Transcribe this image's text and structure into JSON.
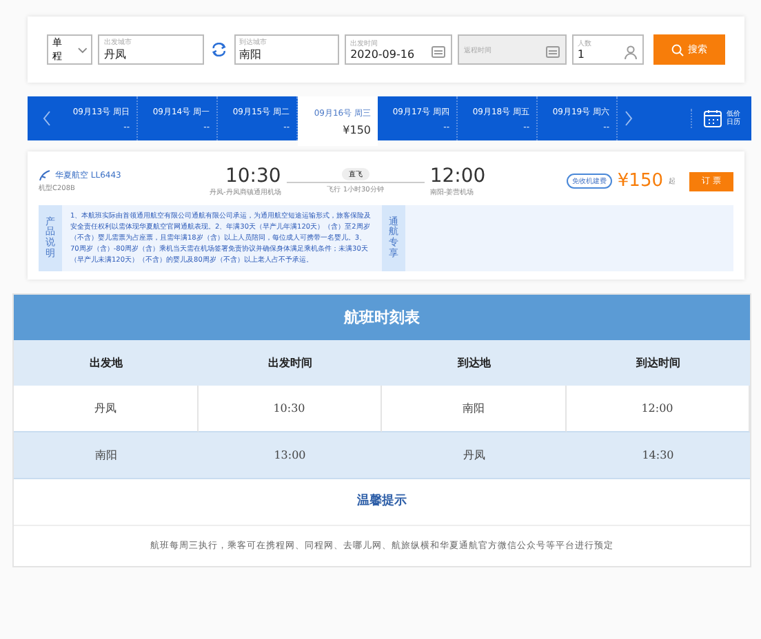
{
  "search": {
    "trip_type": "单程",
    "from": {
      "label": "出发城市",
      "value": "丹凤"
    },
    "to": {
      "label": "到达城市",
      "value": "南阳"
    },
    "depart": {
      "label": "出发时间",
      "value": "2020-09-16"
    },
    "return": {
      "label": "返程时间",
      "disabled": true
    },
    "passengers": {
      "label": "人数",
      "value": "1"
    },
    "button": "搜索"
  },
  "dates": [
    {
      "date": "09月13号 周日",
      "price": "--",
      "selected": false
    },
    {
      "date": "09月14号 周一",
      "price": "--",
      "selected": false
    },
    {
      "date": "09月15号 周二",
      "price": "--",
      "selected": false
    },
    {
      "date": "09月16号 周三",
      "price": "¥150",
      "selected": true
    },
    {
      "date": "09月17号 周四",
      "price": "--",
      "selected": false
    },
    {
      "date": "09月18号 周五",
      "price": "--",
      "selected": false
    },
    {
      "date": "09月19号 周六",
      "price": "--",
      "selected": false
    }
  ],
  "calendar_label": "低价日历",
  "flight": {
    "airline": "华夏航空 LL6443",
    "aircraft": "机型C208B",
    "depart_time": "10:30",
    "depart_airport": "丹凤-丹凤商镇通用机场",
    "type": "直飞",
    "duration": "飞行 1小时30分钟",
    "arrive_time": "12:00",
    "arrive_airport": "南阳-姜营机场",
    "tag": "免收机建费",
    "price": "¥150",
    "price_suffix": "起",
    "book": "订 票",
    "notice_title": "产品说明",
    "notice": "1、本航班实际由首领通用航空有限公司通航有限公司承运，为通用航空短途运输形式，旅客保险及安全责任权利以需体现华夏航空官网通航表现。2、年满30天（早产儿年满120天）（含）至2周岁（不含）婴儿需票为占座票，且需年满18岁（含）以上人员陪同，每位成人可携带一名婴儿。3、70周岁（含）-80周岁（含）乘机当天需在机场签署免责协议并确保身体满足乘机条件；未满30天（早产儿未满120天）（不含）的婴儿及80周岁（不含）以上老人占不予承运。",
    "side_title": "通航专享"
  },
  "timetable": {
    "title": "航班时刻表",
    "columns": [
      "出发地",
      "出发时间",
      "到达地",
      "到达时间"
    ],
    "rows": [
      [
        "丹凤",
        "10:30",
        "南阳",
        "12:00"
      ],
      [
        "南阳",
        "13:00",
        "丹凤",
        "14:30"
      ]
    ],
    "tips_title": "温馨提示",
    "tips": "航班每周三执行，乘客可在携程网、同程网、去哪儿网、航旅纵横和华夏通航官方微信公众号等平台进行预定"
  }
}
